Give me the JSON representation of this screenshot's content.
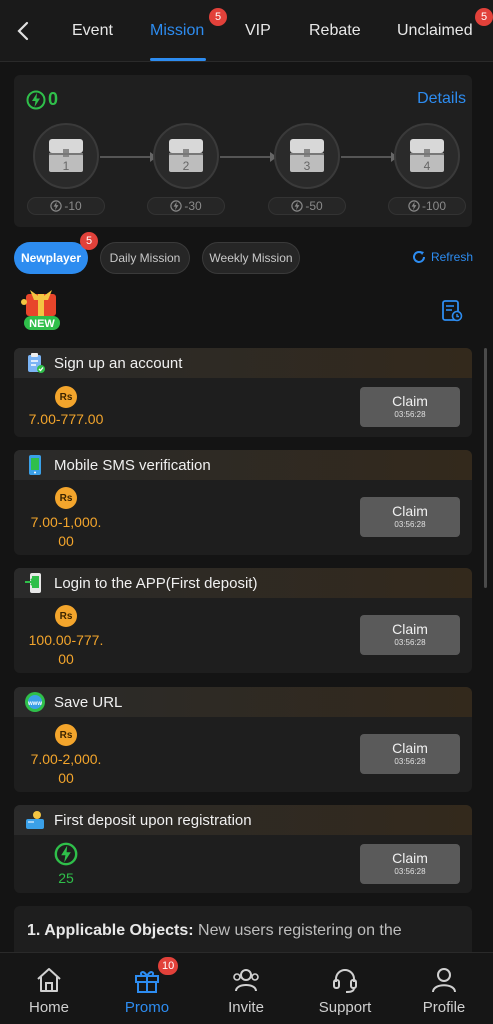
{
  "nav": {
    "tabs": [
      {
        "label": "Event"
      },
      {
        "label": "Mission",
        "badge": "5"
      },
      {
        "label": "VIP"
      },
      {
        "label": "Rebate"
      },
      {
        "label": "Unclaimed",
        "badge": "5"
      }
    ],
    "active_tab": "Mission"
  },
  "level_panel": {
    "points": "0",
    "details_label": "Details",
    "chests": [
      {
        "num": "1",
        "cost": "-10"
      },
      {
        "num": "2",
        "cost": "-30"
      },
      {
        "num": "3",
        "cost": "-50"
      },
      {
        "num": "4",
        "cost": "-100"
      }
    ]
  },
  "filters": {
    "chips": [
      {
        "label": "Newplayer",
        "badge": "5",
        "active": true
      },
      {
        "label": "Daily Mission",
        "active": false
      },
      {
        "label": "Weekly Mission",
        "active": false
      }
    ],
    "refresh_label": "Refresh"
  },
  "new_badge_label": "NEW",
  "missions": [
    {
      "title": "Sign up an account",
      "currency": "Rs",
      "reward_lines": [
        "7.00-777.00"
      ],
      "claim": "Claim",
      "timer": "03:56:28",
      "icon": "clipboard-icon"
    },
    {
      "title": "Mobile SMS verification",
      "currency": "Rs",
      "reward_lines": [
        "7.00-1,000.",
        "00"
      ],
      "claim": "Claim",
      "timer": "03:56:28",
      "icon": "phone-icon"
    },
    {
      "title": "Login to the APP(First deposit)",
      "currency": "Rs",
      "reward_lines": [
        "100.00-777.",
        "00"
      ],
      "claim": "Claim",
      "timer": "03:56:28",
      "icon": "app-login-icon"
    },
    {
      "title": "Save URL",
      "currency": "Rs",
      "reward_lines": [
        "7.00-2,000.",
        "00"
      ],
      "claim": "Claim",
      "timer": "03:56:28",
      "icon": "www-icon"
    },
    {
      "title": "First deposit upon registration",
      "currency": "bolt",
      "reward_lines": [
        "25"
      ],
      "claim": "Claim",
      "timer": "03:56:28",
      "icon": "deposit-icon"
    }
  ],
  "info": {
    "heading": "1. Applicable Objects:",
    "text": " New users registering on the"
  },
  "bottom_nav": {
    "items": [
      {
        "label": "Home"
      },
      {
        "label": "Promo",
        "badge": "10"
      },
      {
        "label": "Invite"
      },
      {
        "label": "Support"
      },
      {
        "label": "Profile"
      }
    ],
    "active": "Promo"
  },
  "colors": {
    "accent": "#2d8cf0",
    "bolt": "#2fbf4a",
    "coin": "#f3a52c",
    "badge": "#e2413a"
  }
}
